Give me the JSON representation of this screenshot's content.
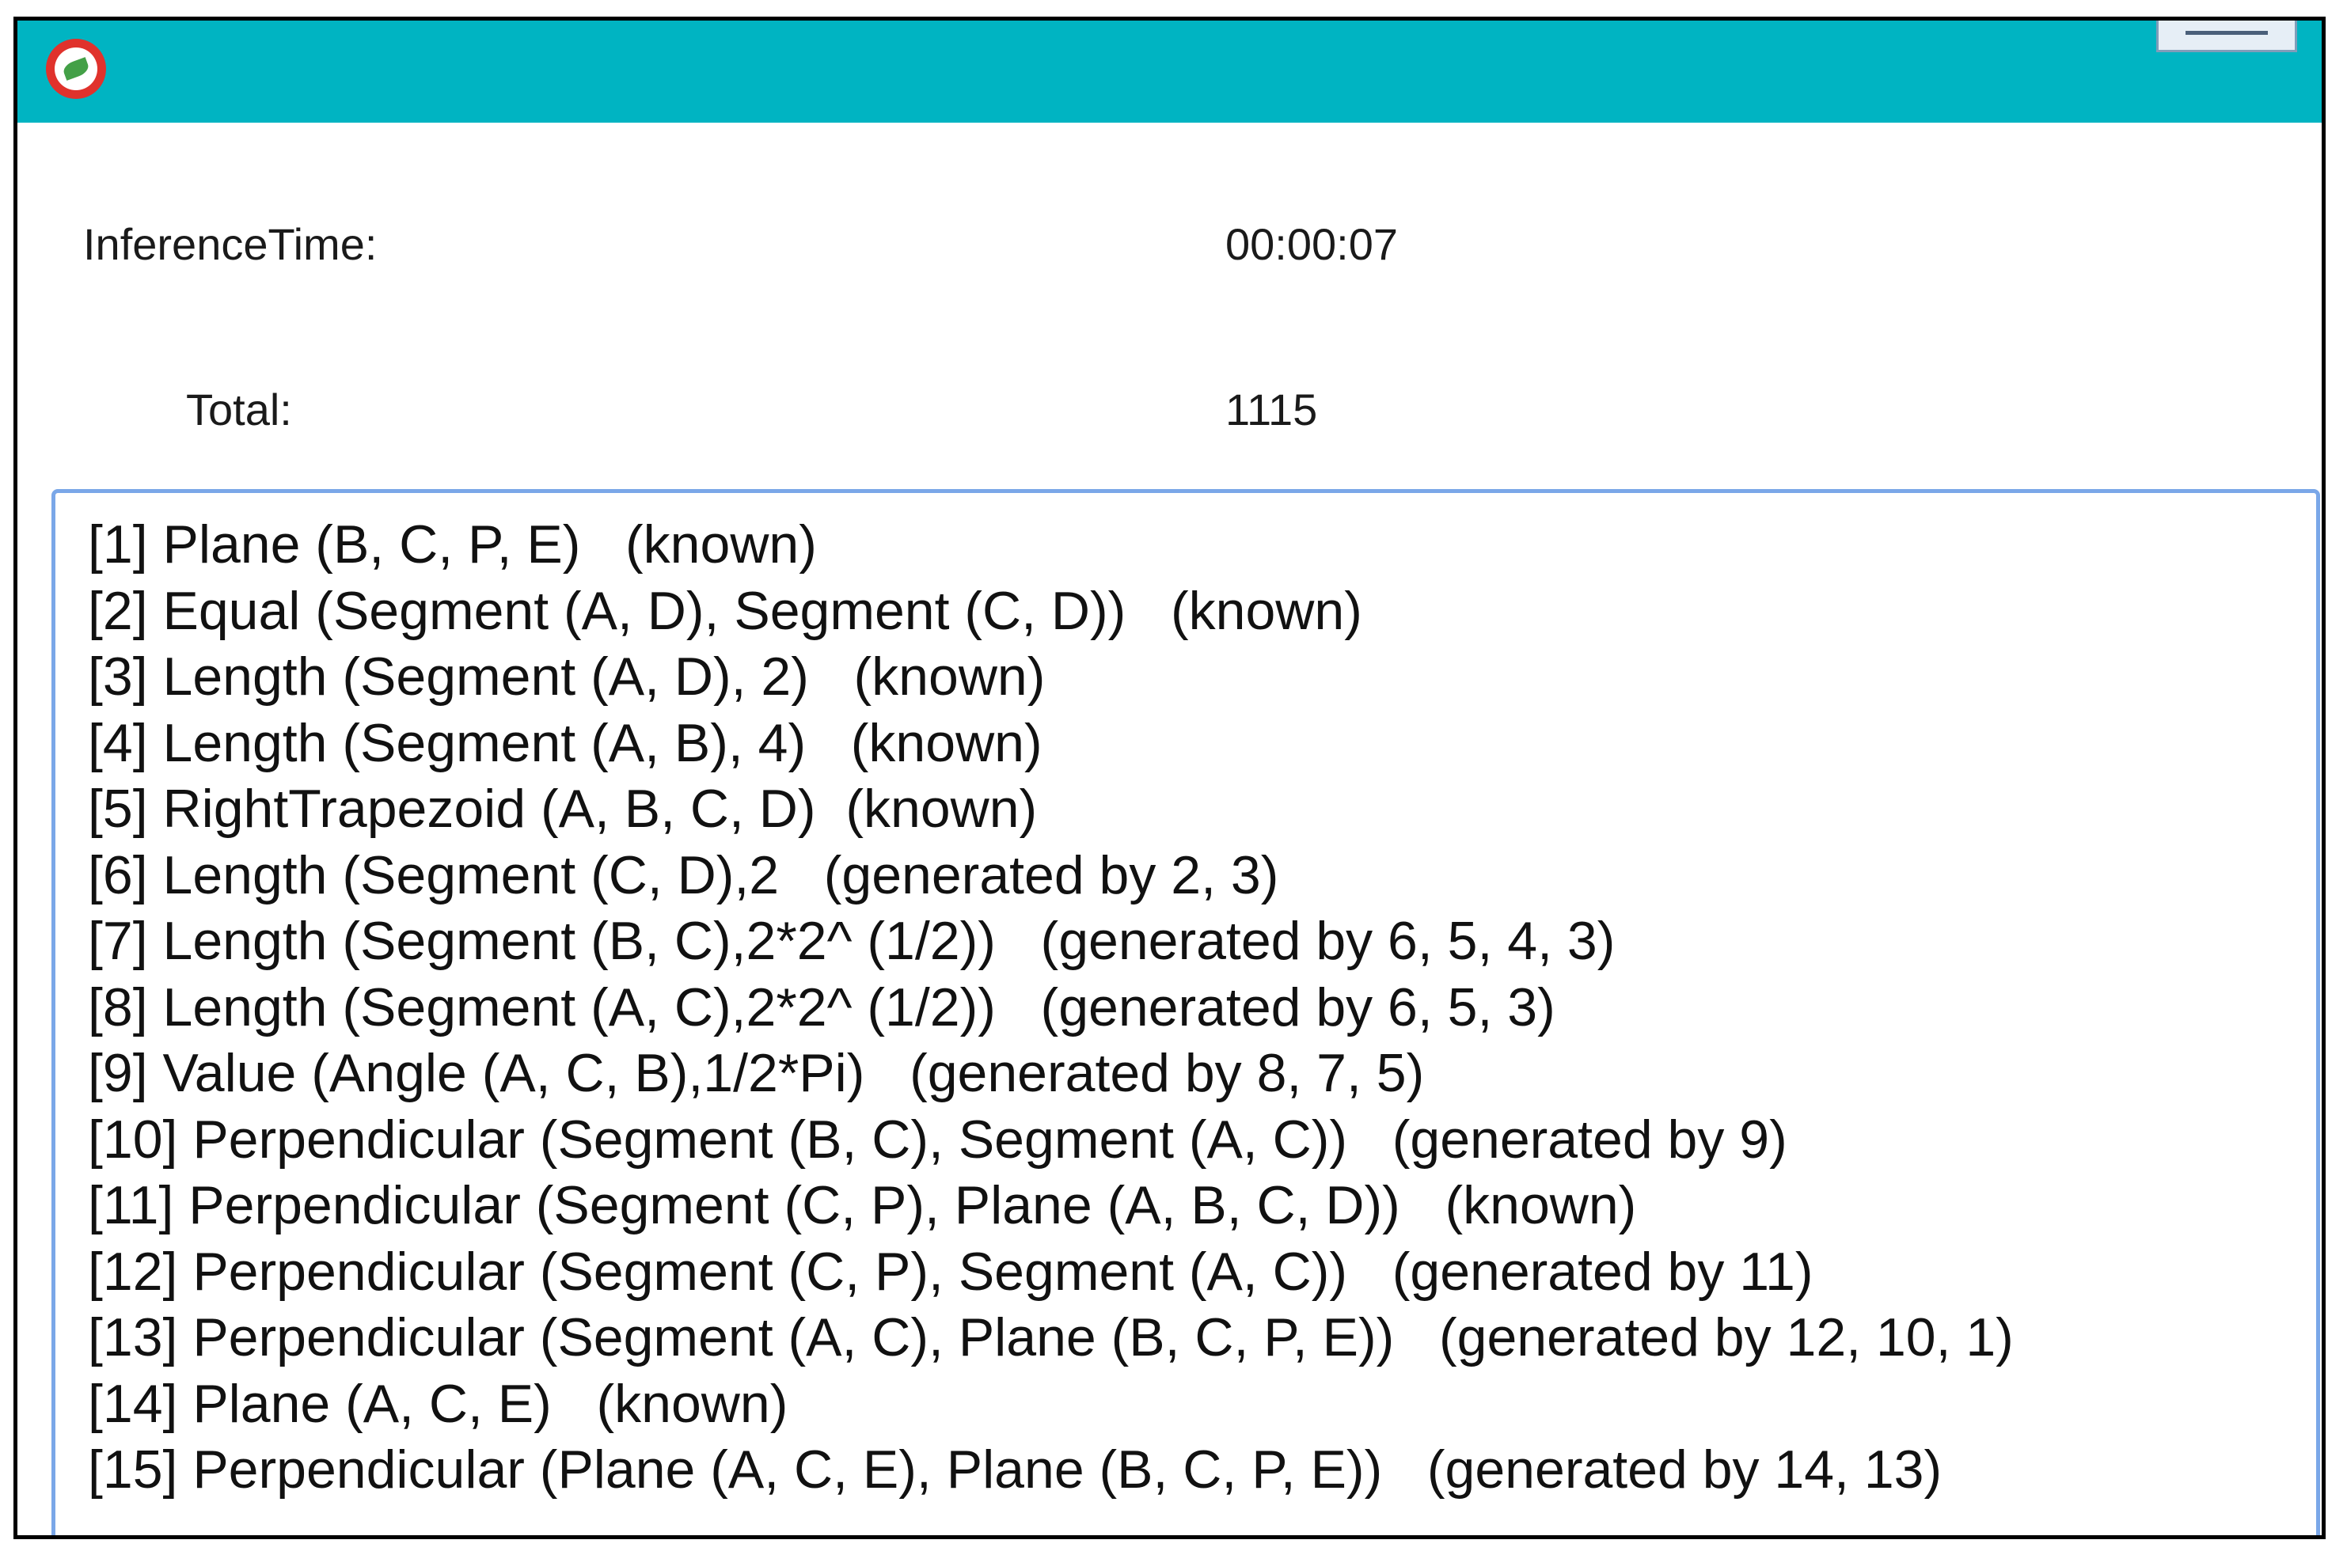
{
  "window": {
    "icon": "app-logo-icon",
    "controls": {
      "minimize_icon": "minimize-icon"
    }
  },
  "stats": {
    "inference_label": "InferenceTime:",
    "inference_value": "00:00:07",
    "total_label": "Total:",
    "total_value": "1115"
  },
  "results": [
    "[1] Plane (B, C, P, E)   (known)",
    "[2] Equal (Segment (A, D), Segment (C, D))   (known)",
    "[3] Length (Segment (A, D), 2)   (known)",
    "[4] Length (Segment (A, B), 4)   (known)",
    "[5] RightTrapezoid (A, B, C, D)  (known)",
    "[6] Length (Segment (C, D),2   (generated by 2, 3)",
    "[7] Length (Segment (B, C),2*2^ (1/2))   (generated by 6, 5, 4, 3)",
    "[8] Length (Segment (A, C),2*2^ (1/2))   (generated by 6, 5, 3)",
    "[9] Value (Angle (A, C, B),1/2*Pi)   (generated by 8, 7, 5)",
    "[10] Perpendicular (Segment (B, C), Segment (A, C))   (generated by 9)",
    "[11] Perpendicular (Segment (C, P), Plane (A, B, C, D))   (known)",
    "[12] Perpendicular (Segment (C, P), Segment (A, C))   (generated by 11)",
    "[13] Perpendicular (Segment (A, C), Plane (B, C, P, E))   (generated by 12, 10, 1)",
    "[14] Plane (A, C, E)   (known)",
    "[15] Perpendicular (Plane (A, C, E), Plane (B, C, P, E))   (generated by 14, 13)"
  ]
}
